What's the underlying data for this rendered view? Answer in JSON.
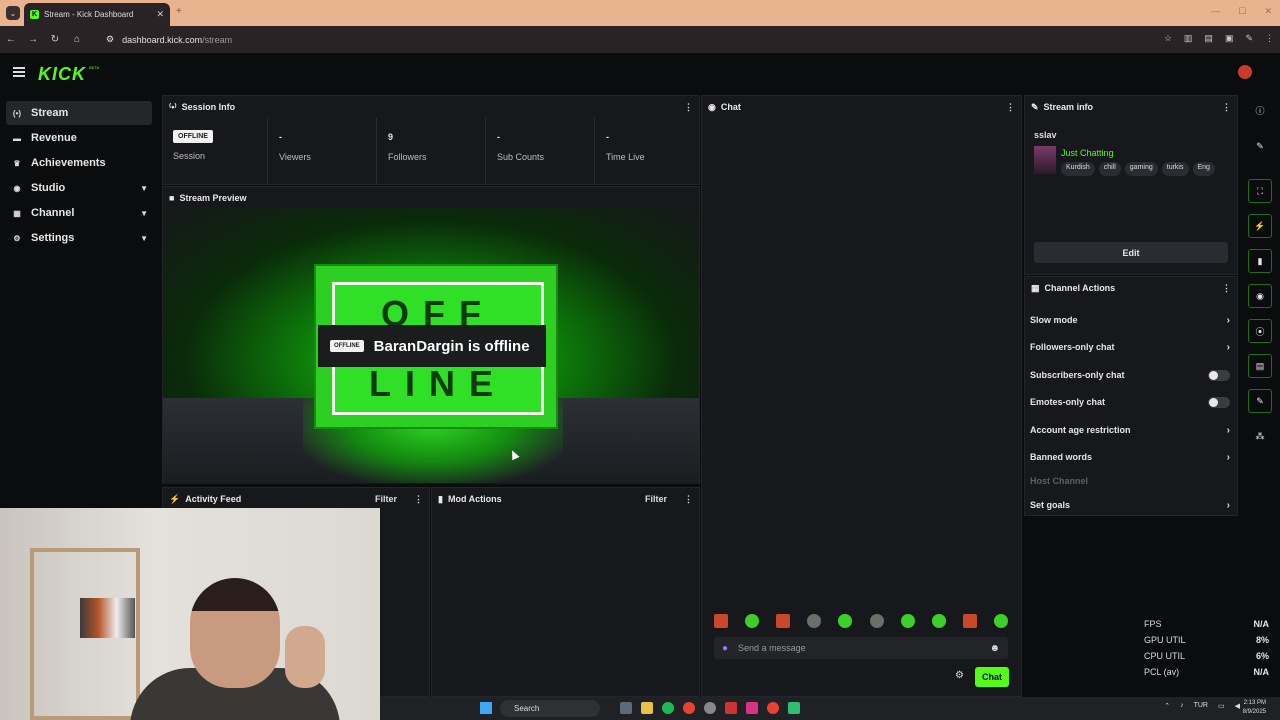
{
  "browser": {
    "tab_title": "Stream - Kick Dashboard",
    "tab_close": "✕",
    "new_tab": "+",
    "url_host": "dashboard.kick.com",
    "url_path": "/stream"
  },
  "app": {
    "logo": "KICK",
    "beta": "BETA"
  },
  "sidebar": {
    "items": [
      {
        "label": "Stream",
        "icon": "(•)"
      },
      {
        "label": "Revenue",
        "icon": "▬"
      },
      {
        "label": "Achievements",
        "icon": "♛"
      },
      {
        "label": "Studio",
        "icon": "◉"
      },
      {
        "label": "Channel",
        "icon": "▦"
      },
      {
        "label": "Settings",
        "icon": "⚙"
      }
    ]
  },
  "session": {
    "title": "Session Info",
    "status_badge": "OFFLINE",
    "session_label": "Session",
    "stats": [
      {
        "value": "-",
        "label": "Viewers"
      },
      {
        "value": "9",
        "label": "Followers"
      },
      {
        "value": "-",
        "label": "Sub Counts"
      },
      {
        "value": "-",
        "label": "Time Live"
      }
    ]
  },
  "preview": {
    "title": "Stream Preview",
    "badge": "OFFLINE",
    "message": "BaranDargin is offline",
    "word_top": "OFF",
    "word_bottom": "LINE"
  },
  "activity": {
    "title": "Activity Feed",
    "filter": "Filter"
  },
  "mod": {
    "title": "Mod Actions",
    "filter": "Filter"
  },
  "chat": {
    "title": "Chat",
    "placeholder": "Send a message",
    "send": "Chat"
  },
  "stream_info": {
    "title": "Stream info",
    "stream_title": "sslav",
    "category": "Just Chatting",
    "tags": [
      "Kurdish",
      "chill",
      "gaming",
      "turkis",
      "Eng"
    ],
    "edit": "Edit"
  },
  "channel_actions": {
    "title": "Channel Actions",
    "items": [
      {
        "label": "Slow mode",
        "kind": "arrow"
      },
      {
        "label": "Followers-only chat",
        "kind": "arrow"
      },
      {
        "label": "Subscribers-only chat",
        "kind": "toggle"
      },
      {
        "label": "Emotes-only chat",
        "kind": "toggle"
      },
      {
        "label": "Account age restriction",
        "kind": "arrow"
      },
      {
        "label": "Banned words",
        "kind": "arrow"
      },
      {
        "label": "Host Channel",
        "kind": "disabled"
      },
      {
        "label": "Set goals",
        "kind": "arrow"
      }
    ]
  },
  "perf": {
    "rows": [
      {
        "label": "FPS",
        "value": "N/A"
      },
      {
        "label": "GPU UTIL",
        "value": "8%"
      },
      {
        "label": "CPU UTIL",
        "value": "6%"
      },
      {
        "label": "PCL (av)",
        "value": "N/A"
      }
    ]
  },
  "taskbar": {
    "search": "Search",
    "lang": "TUR",
    "time": "2:13 PM",
    "date": "8/9/2025"
  },
  "colors": {
    "accent": "#53fc18",
    "panel": "#17181b",
    "bg": "#0b0c0e"
  }
}
